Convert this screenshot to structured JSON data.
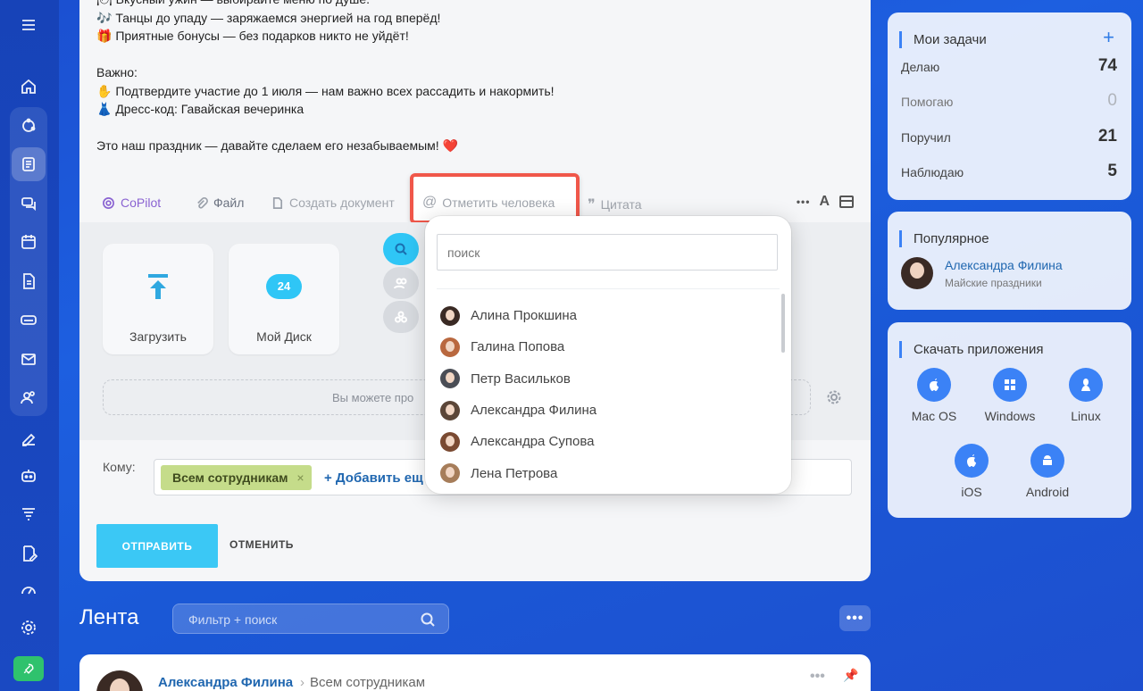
{
  "message": {
    "lines": [
      "🍽 Вкусный ужин — выбирайте меню по душе.",
      "🎶 Танцы до упаду — заряжаемся энергией на год вперёд!",
      "🎁 Приятные бонусы — без подарков никто не уйдёт!",
      "",
      "Важно:",
      "✋ Подтвердите участие до 1 июля — нам важно всех рассадить и накормить!",
      "👗 Дресс-код: Гавайская вечеринка",
      "",
      "Это наш праздник — давайте сделаем его незабываемым! ❤️"
    ]
  },
  "toolbar": {
    "copilot": "CoPilot",
    "file": "Файл",
    "create_doc": "Создать документ",
    "mention": "Отметить человека",
    "quote": "Цитата",
    "more": "•••",
    "font": "A"
  },
  "attach": {
    "upload": "Загрузить",
    "my_disk": "Мой Диск",
    "disk_badge": "24",
    "drop_hint": "Вы можете про"
  },
  "recipients": {
    "label": "Кому:",
    "chip": "Всем сотрудникам",
    "add_more": "+ Добавить ещ"
  },
  "buttons": {
    "send": "ОТПРАВИТЬ",
    "cancel": "ОТМЕНИТЬ"
  },
  "mention_popup": {
    "search_placeholder": "поиск",
    "people": [
      "Алина Прокшина",
      "Галина Попова",
      "Петр Васильков",
      "Александра Филина",
      "Александра Супова",
      "Лена Петрова"
    ]
  },
  "feed": {
    "title": "Лента",
    "filter_placeholder": "Фильтр + поиск",
    "more": "•••",
    "post": {
      "author": "Александра Филина",
      "recipient": "Всем сотрудникам",
      "separator": "›"
    }
  },
  "tasks": {
    "title": "Мои задачи",
    "add": "+",
    "rows": [
      {
        "label": "Делаю",
        "count": "74"
      },
      {
        "label": "Помогаю",
        "count": "0"
      },
      {
        "label": "Поручил",
        "count": "21"
      },
      {
        "label": "Наблюдаю",
        "count": "5"
      }
    ]
  },
  "popular": {
    "title": "Популярное",
    "name": "Александра Филина",
    "subtitle": "Майские праздники"
  },
  "apps": {
    "title": "Скачать приложения",
    "items": [
      "Mac OS",
      "Windows",
      "Linux",
      "iOS",
      "Android"
    ]
  },
  "colors": {
    "accent": "#3bc8f5",
    "highlight": "#f0574a",
    "link": "#2067b0",
    "chip": "#c5dc8a"
  }
}
